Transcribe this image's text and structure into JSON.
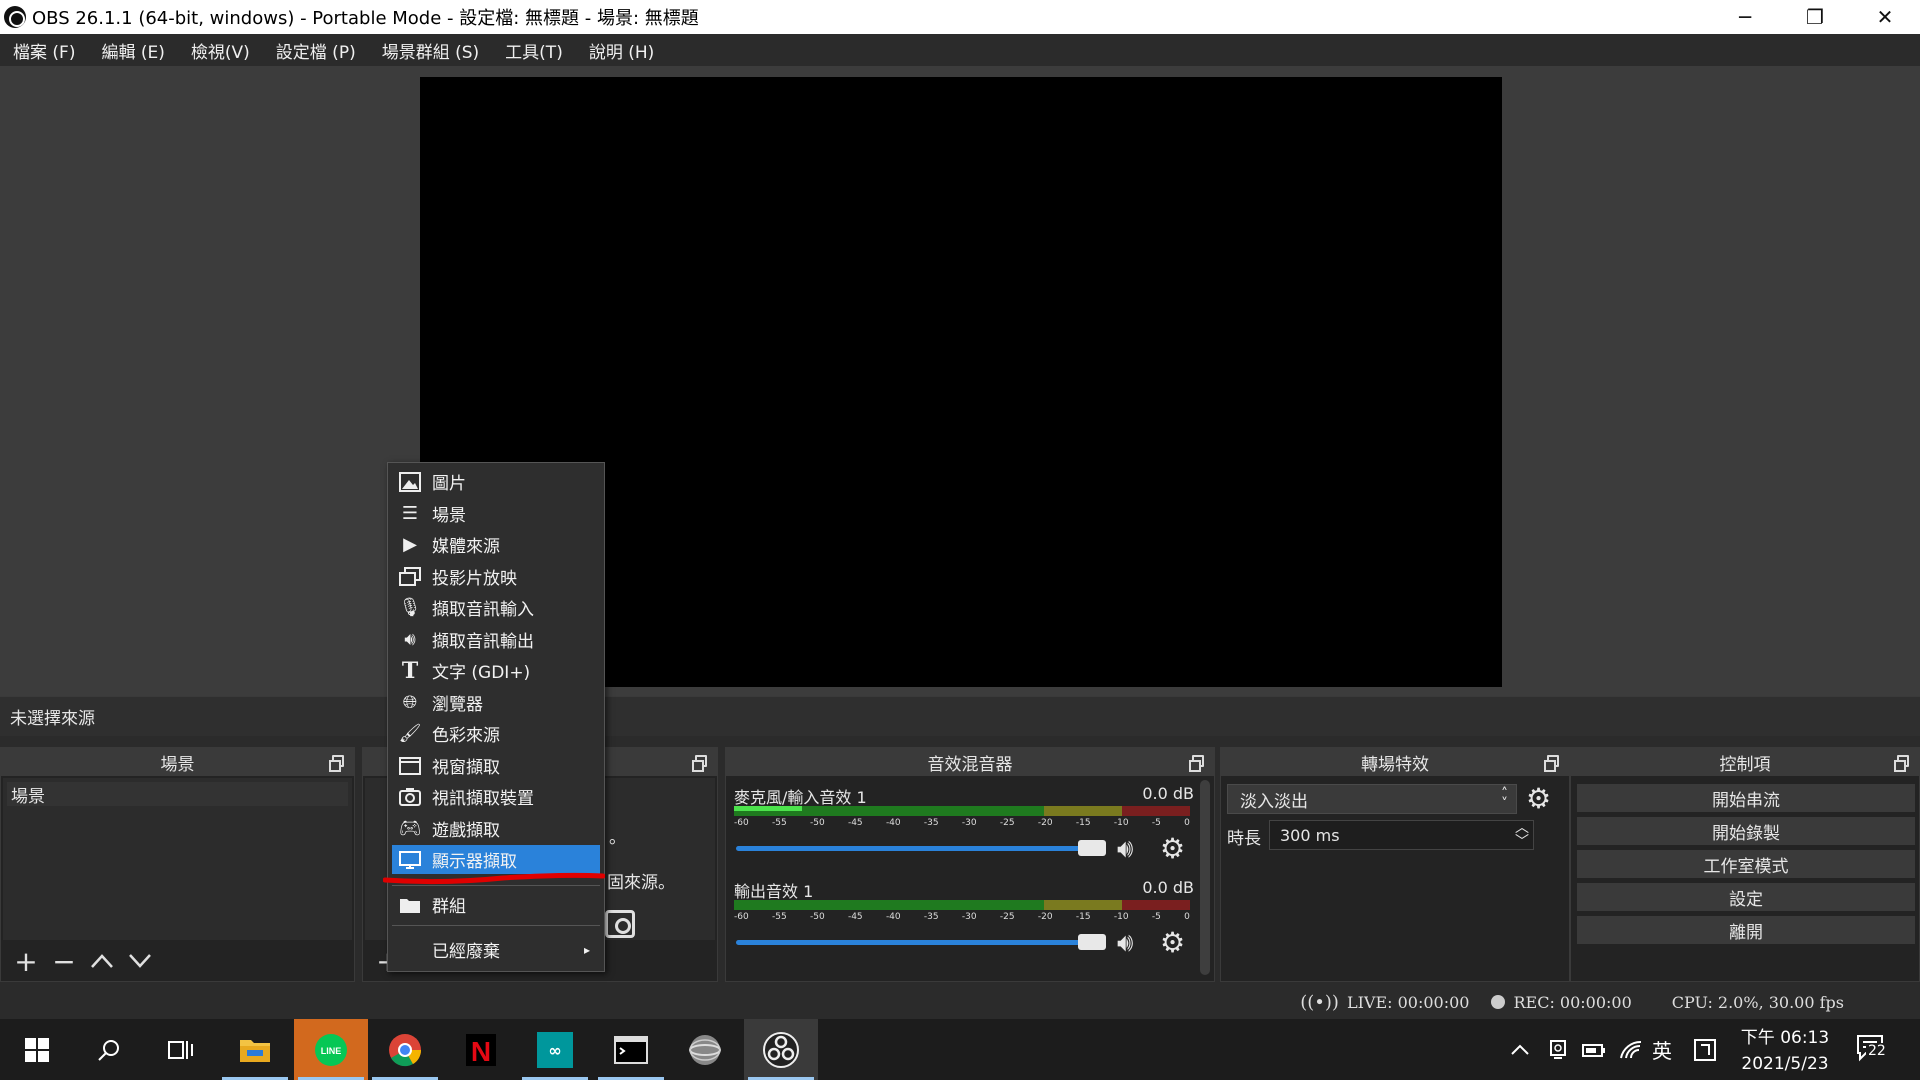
{
  "window": {
    "title": "OBS 26.1.1 (64-bit, windows) - Portable Mode - 設定檔: 無標題 - 場景: 無標題",
    "minimize": "─",
    "maximize": "❐",
    "close": "✕"
  },
  "menubar": {
    "items": [
      "檔案 (F)",
      "編輯 (E)",
      "檢視(V)",
      "設定檔 (P)",
      "場景群組 (S)",
      "工具(T)",
      "說明 (H)"
    ]
  },
  "source_status": "未選擇來源",
  "docks": {
    "scenes": {
      "title": "場景",
      "items": [
        "場景"
      ]
    },
    "sources": {
      "dot_text": "。",
      "hint": "固來源。"
    },
    "mixer": {
      "title": "音效混音器",
      "channels": [
        {
          "name": "麥克風/輸入音效 1",
          "db": "0.0 dB",
          "level": 0.15
        },
        {
          "name": "輸出音效 1",
          "db": "0.0 dB",
          "level": 0.0
        }
      ],
      "ticks": [
        "-60",
        "-55",
        "-50",
        "-45",
        "-40",
        "-35",
        "-30",
        "-25",
        "-20",
        "-15",
        "-10",
        "-5",
        "0"
      ]
    },
    "transitions": {
      "title": "轉場特效",
      "selected": "淡入淡出",
      "duration_label": "時長",
      "duration_value": "300 ms"
    },
    "controls": {
      "title": "控制項",
      "buttons": [
        "開始串流",
        "開始錄製",
        "工作室模式",
        "設定",
        "離開"
      ]
    }
  },
  "context_menu": {
    "items": [
      {
        "label": "圖片",
        "icon": "image-icon"
      },
      {
        "label": "場景",
        "icon": "list-icon"
      },
      {
        "label": "媒體來源",
        "icon": "play-icon"
      },
      {
        "label": "投影片放映",
        "icon": "slideshow-icon"
      },
      {
        "label": "擷取音訊輸入",
        "icon": "microphone-icon"
      },
      {
        "label": "擷取音訊輸出",
        "icon": "speaker-icon"
      },
      {
        "label": "文字 (GDI+)",
        "icon": "text-icon"
      },
      {
        "label": "瀏覽器",
        "icon": "globe-icon"
      },
      {
        "label": "色彩來源",
        "icon": "brush-icon"
      },
      {
        "label": "視窗擷取",
        "icon": "window-icon"
      },
      {
        "label": "視訊擷取裝置",
        "icon": "camera-icon"
      },
      {
        "label": "遊戲擷取",
        "icon": "gamepad-icon"
      },
      {
        "label": "顯示器擷取",
        "icon": "monitor-icon"
      }
    ],
    "group_label": "群組",
    "deprecated_label": "已經廢棄",
    "highlight_color": "#2a82da"
  },
  "statusbar": {
    "live": "LIVE: 00:00:00",
    "rec": "REC: 00:00:00",
    "cpu": "CPU: 2.0%, 30.00 fps"
  },
  "taskbar": {
    "clock_ampm": "下午 06:13",
    "date": "2021/5/23",
    "ime": "英",
    "notification_count": "22"
  },
  "colors": {
    "accent": "#2a82da",
    "meter_green": "#4ce34c",
    "annotation_red": "#e00000"
  }
}
